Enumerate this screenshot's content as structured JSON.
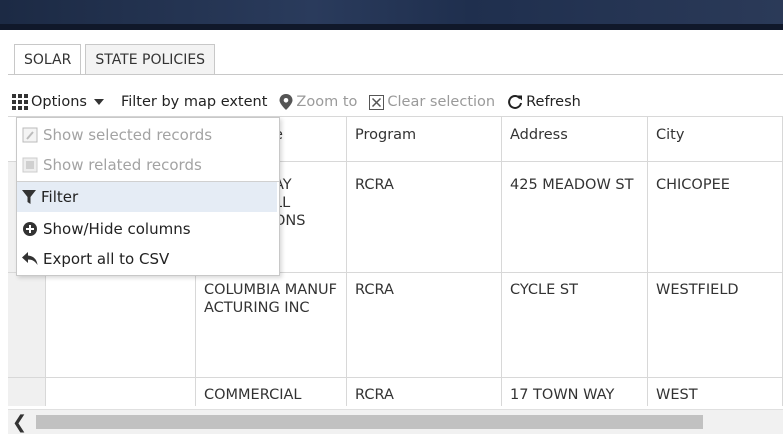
{
  "tabs": [
    {
      "label": "SOLAR",
      "active": true
    },
    {
      "label": "STATE POLICIES",
      "active": false
    }
  ],
  "toolbar": {
    "options_label": "Options",
    "filter_extent_label": "Filter by map extent",
    "zoom_label": "Zoom to",
    "clear_label": "Clear selection",
    "refresh_label": "Refresh"
  },
  "menu": {
    "items": [
      {
        "label": "Show selected records",
        "enabled": false,
        "icon": "select-icon"
      },
      {
        "label": "Show related records",
        "enabled": false,
        "icon": "related-icon"
      },
      {
        "label": "Filter",
        "enabled": true,
        "icon": "filter-icon"
      },
      {
        "label": "Show/Hide columns",
        "enabled": true,
        "icon": "plus-circle-icon"
      },
      {
        "label": "Export all to CSV",
        "enabled": true,
        "icon": "share-icon"
      }
    ]
  },
  "table": {
    "headers": [
      "e",
      "Program",
      "Address",
      "City"
    ],
    "rows": [
      [
        "AY\nLL\nONS",
        "RCRA",
        "425 MEADOW ST",
        "CHICOPEE"
      ],
      [
        "COLUMBIA MANUFACTURING INC",
        "RCRA",
        "CYCLE ST",
        "WESTFIELD"
      ],
      [
        "COMMERCIAL",
        "RCRA",
        "17 TOWN WAY",
        "WEST"
      ]
    ]
  },
  "colors": {
    "accent": "#1c2a44",
    "menu_hover": "#e5ecf5"
  }
}
